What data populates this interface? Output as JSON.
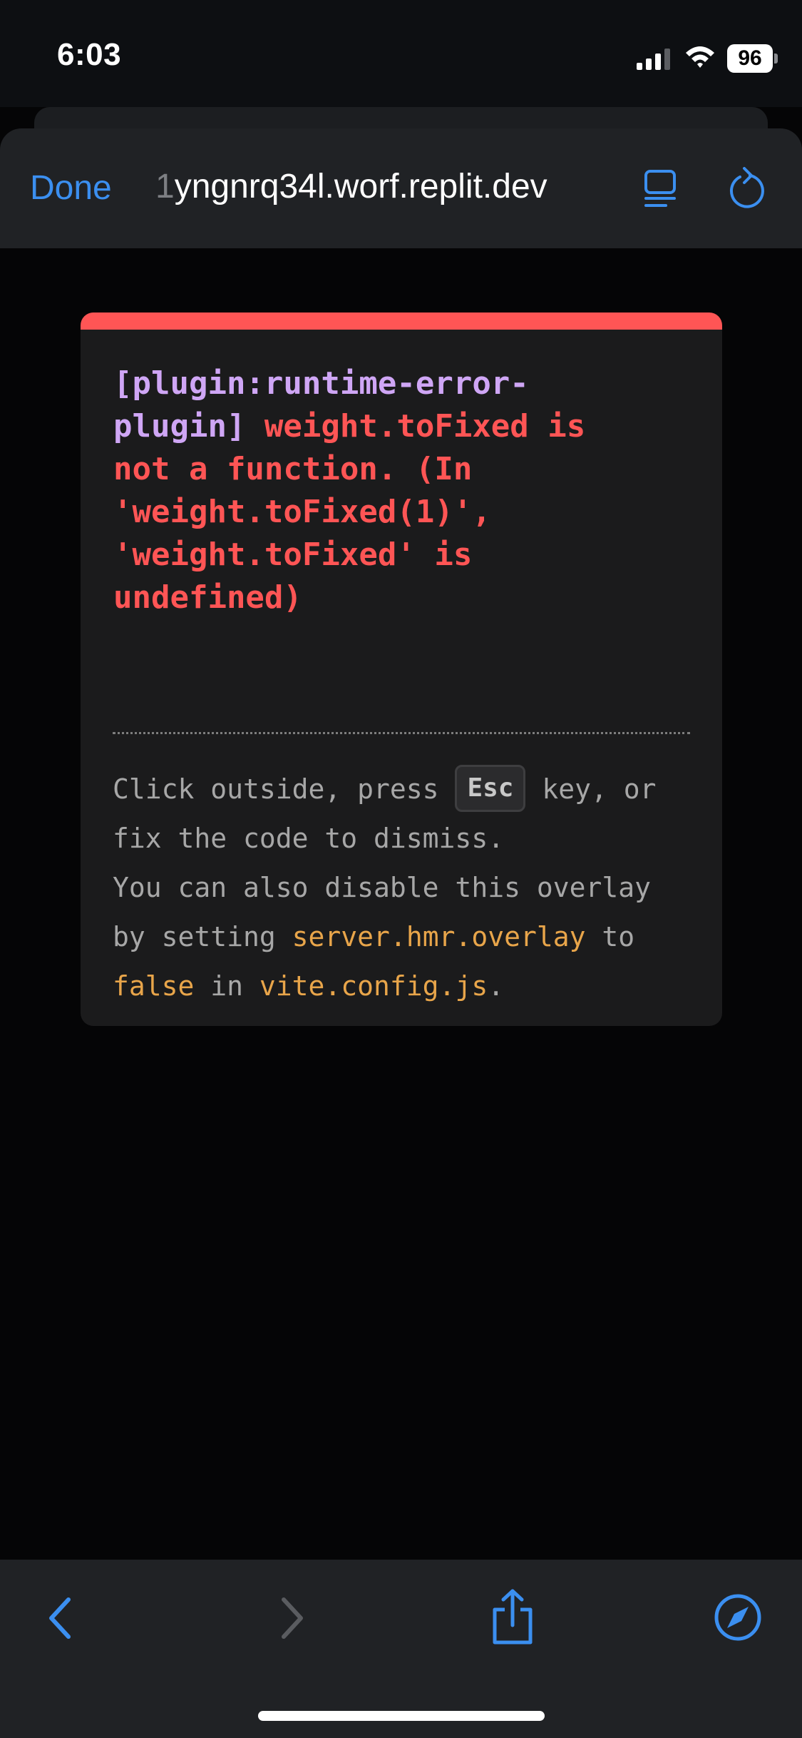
{
  "status_bar": {
    "time": "6:03",
    "battery_level": "96",
    "signal_icon": "cellular-signal-icon",
    "wifi_icon": "wifi-icon"
  },
  "browser": {
    "done_label": "Done",
    "url_faded_prefix": "1",
    "url": "yngnrq34l.worf.replit.dev",
    "reader_icon": "reader-mode-icon",
    "reload_icon": "reload-icon",
    "accent_color": "#3b8ff0"
  },
  "overlay": {
    "accent_color": "#ff5555",
    "plugin_tag": "[plugin:runtime-error-\nplugin]",
    "message_first": " weight.toFixed is",
    "message_rest": "\nnot a function. (In\n'weight.toFixed(1)',\n'weight.toFixed' is\nundefined)",
    "tip": {
      "part1": "Click outside, press ",
      "key": "Esc",
      "part2": " key, or\nfix the code to dismiss.\nYou can also disable this overlay\nby setting ",
      "config_key": "server.hmr.overlay",
      "part3": " to\n",
      "false_value": "false",
      "part4": " in ",
      "config_file": "vite.config.js",
      "part5": "."
    }
  },
  "toolbar": {
    "back_icon": "back-chevron-icon",
    "forward_icon": "forward-chevron-icon",
    "share_icon": "share-icon",
    "open_in_safari_icon": "compass-icon"
  }
}
